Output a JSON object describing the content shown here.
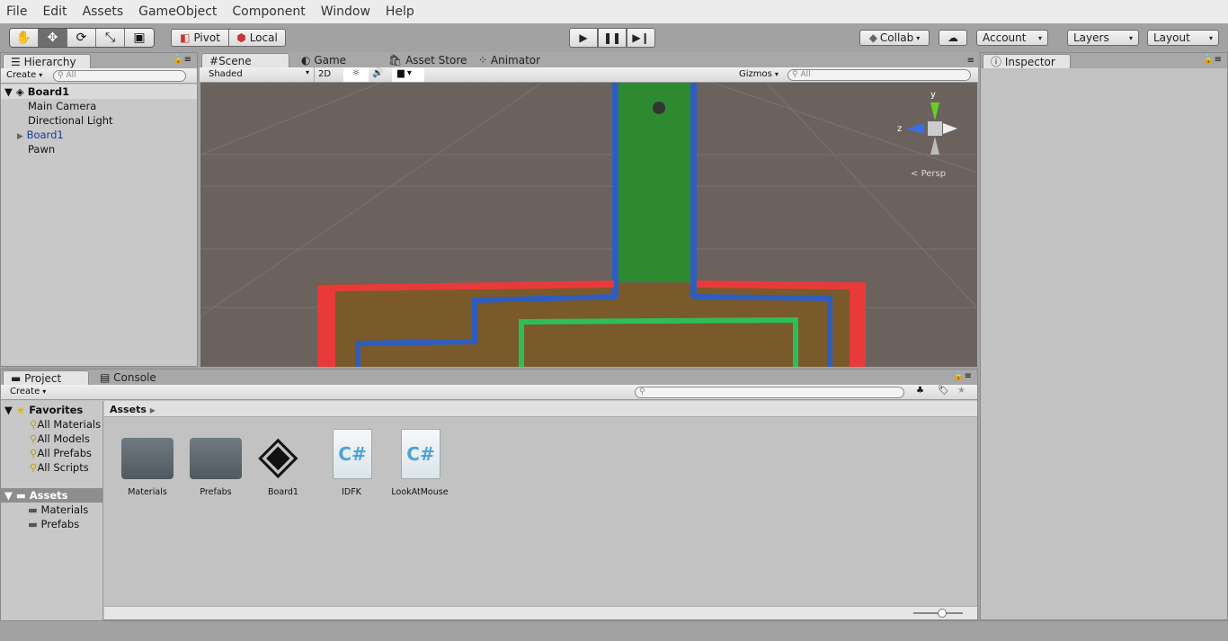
{
  "menu": [
    "File",
    "Edit",
    "Assets",
    "GameObject",
    "Component",
    "Window",
    "Help"
  ],
  "toolbar": {
    "tools": [
      "hand",
      "move",
      "rotate",
      "scale",
      "rect"
    ],
    "pivot": "Pivot",
    "local": "Local",
    "collab": "Collab",
    "account": "Account",
    "layers": "Layers",
    "layout": "Layout"
  },
  "hierarchy": {
    "tab": "Hierarchy",
    "create": "Create",
    "search_placeholder": "All",
    "scene": "Board1",
    "items": [
      {
        "label": "Main Camera"
      },
      {
        "label": "Directional Light"
      },
      {
        "label": "Board1",
        "prefab": true
      },
      {
        "label": "Pawn"
      }
    ]
  },
  "scene": {
    "tabs": [
      "Scene",
      "Game",
      "Asset Store",
      "Animator"
    ],
    "shading": "Shaded",
    "mode2d": "2D",
    "gizmos": "Gizmos",
    "search_placeholder": "All",
    "persp": "Persp",
    "axis_y": "y",
    "axis_z": "z"
  },
  "inspector": {
    "tab": "Inspector"
  },
  "project": {
    "tabs": [
      "Project",
      "Console"
    ],
    "create": "Create",
    "favorites_label": "Favorites",
    "favorites": [
      "All Materials",
      "All Models",
      "All Prefabs",
      "All Scripts"
    ],
    "assets_label": "Assets",
    "asset_folders": [
      "Materials",
      "Prefabs"
    ],
    "breadcrumb": "Assets",
    "assets": [
      {
        "name": "Materials",
        "type": "folder"
      },
      {
        "name": "Prefabs",
        "type": "folder"
      },
      {
        "name": "Board1",
        "type": "unity-scene"
      },
      {
        "name": "IDFK",
        "type": "csharp"
      },
      {
        "name": "LookAtMouse",
        "type": "csharp"
      }
    ],
    "cs_glyph": "C#"
  },
  "colors": {
    "red_wall": "#e83a3a",
    "blue_wall": "#2f5dbd",
    "green_wall": "#2fbd5a",
    "floor": "#7a5a2a",
    "green_floor": "#2e8a30",
    "scene_bg": "#6b625d"
  }
}
